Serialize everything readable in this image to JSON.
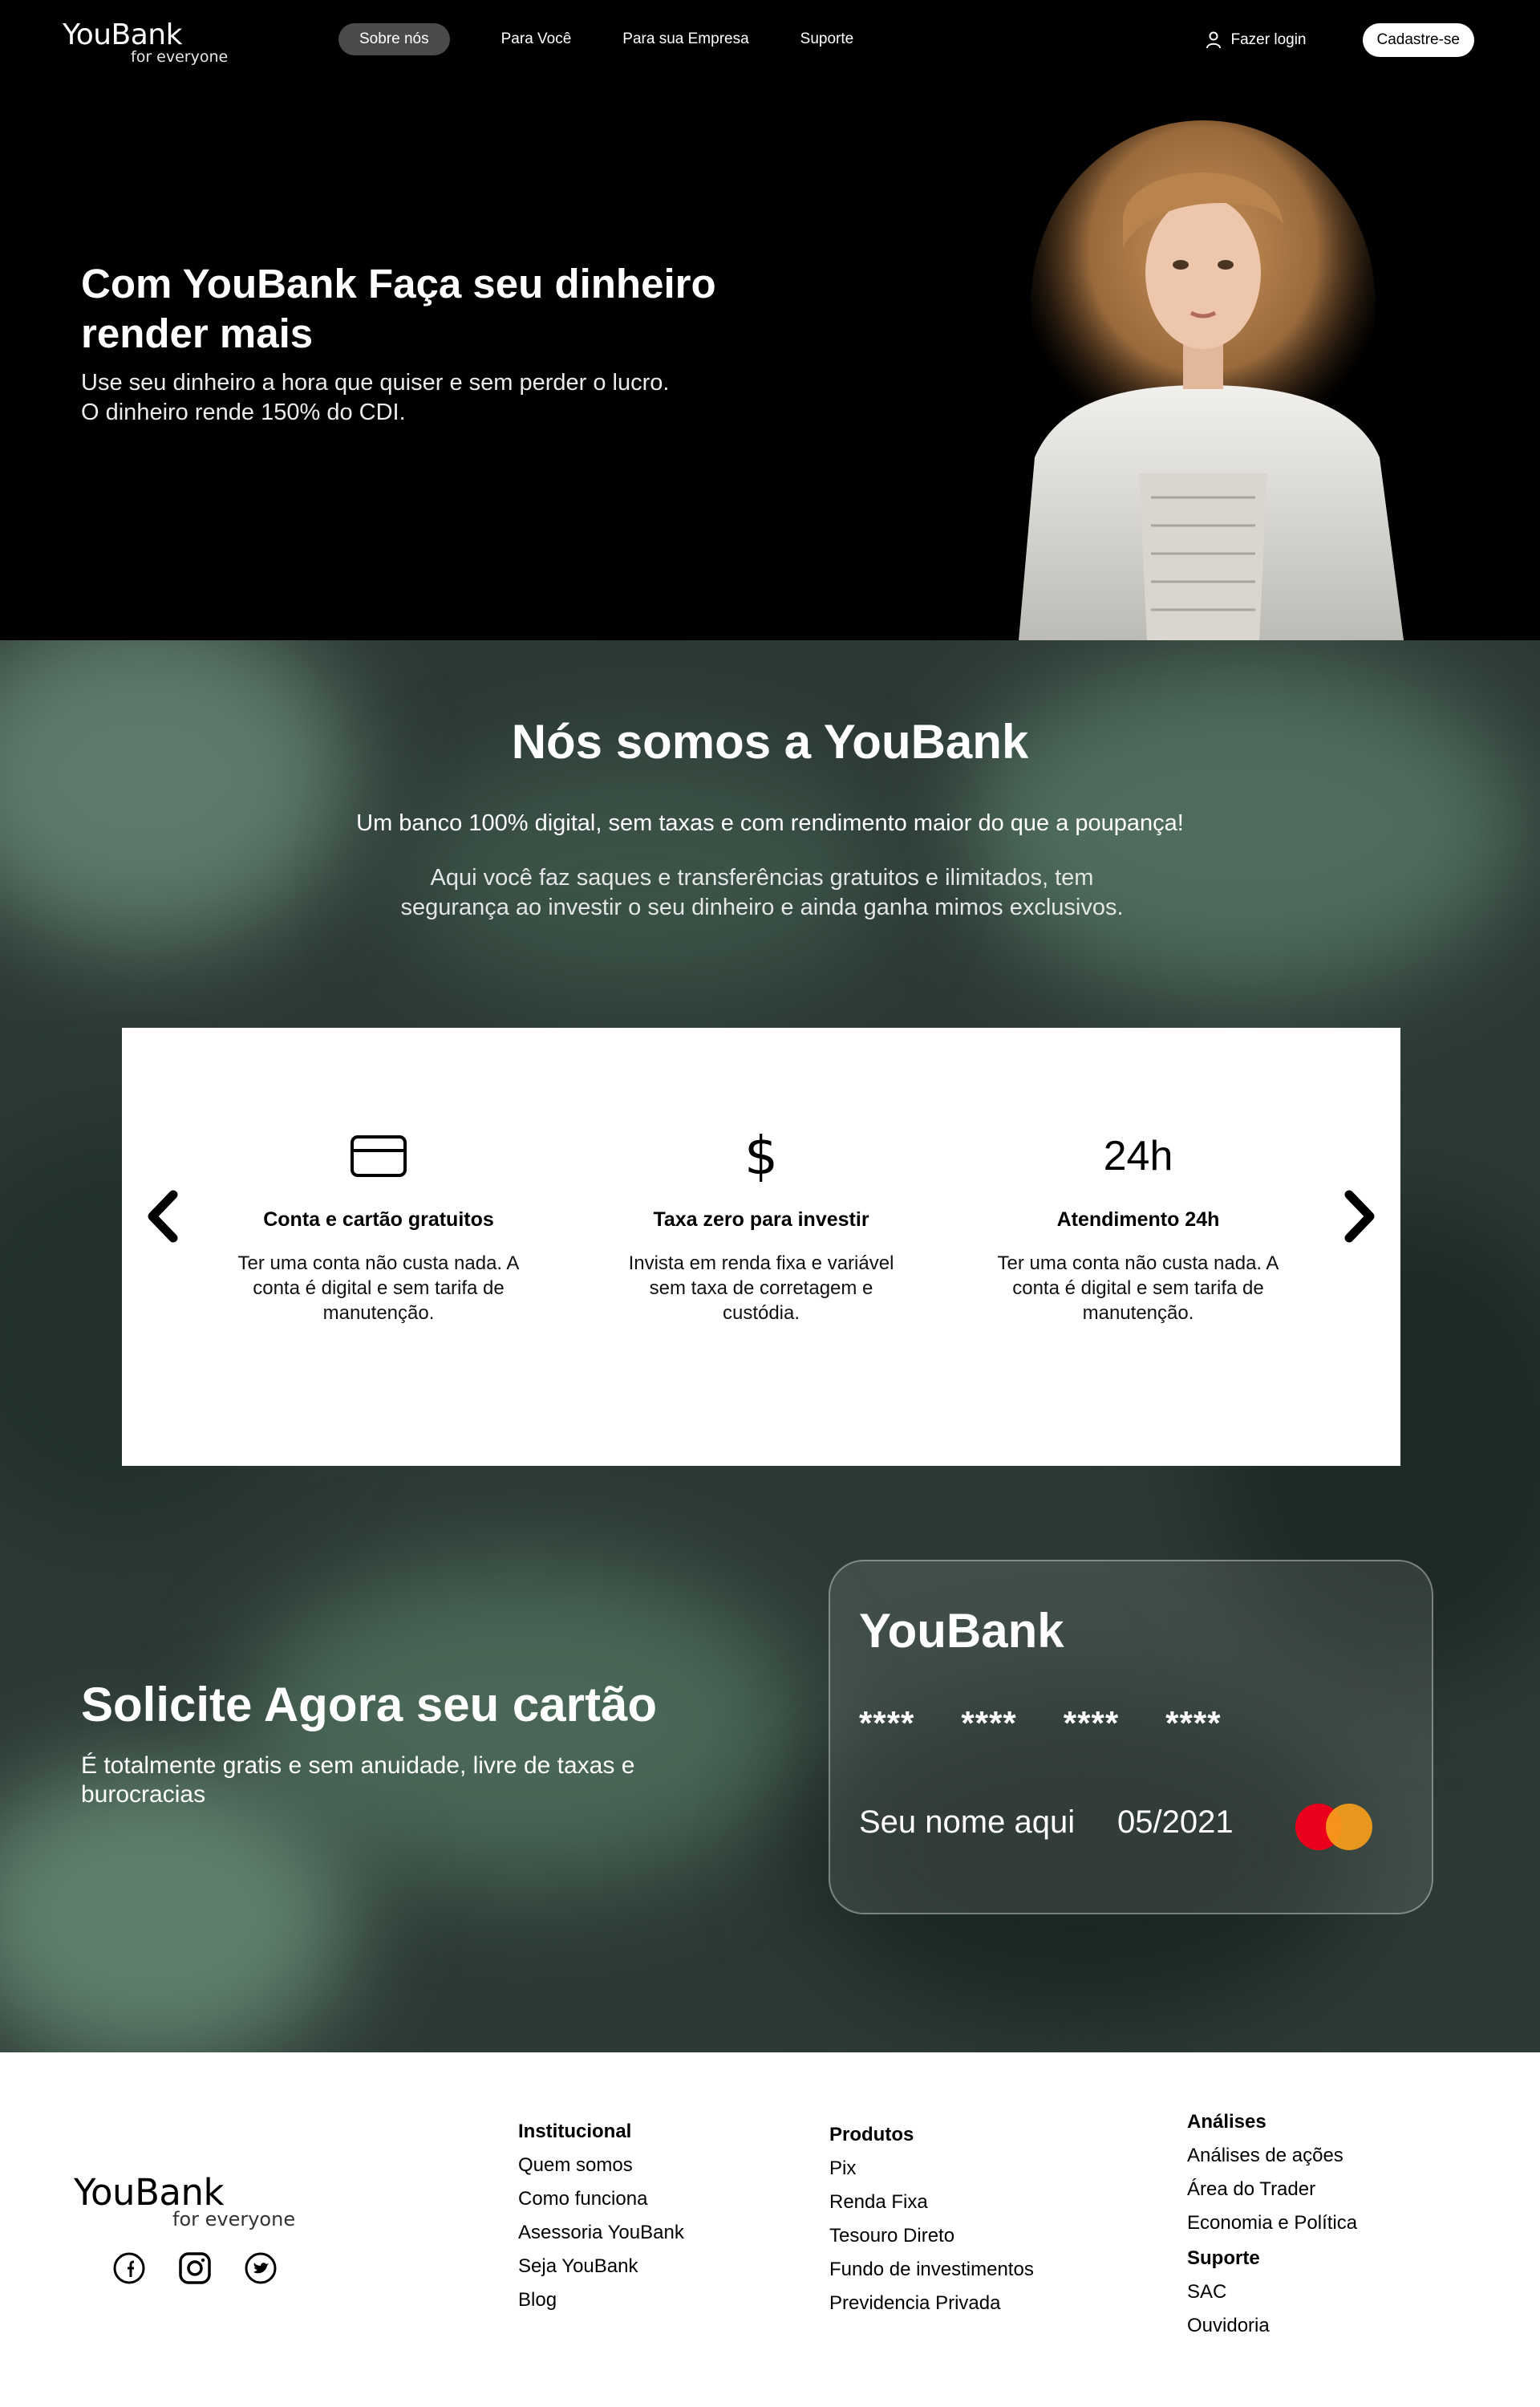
{
  "header": {
    "brand": "YouBank",
    "tagline": "for everyone",
    "nav": [
      "Sobre nós",
      "Para Você",
      "Para sua Empresa",
      "Suporte"
    ],
    "login": "Fazer login",
    "signup": "Cadastre-se"
  },
  "hero": {
    "title": "Com YouBank Faça seu dinheiro render mais",
    "subtitle": "Use seu dinheiro a hora que quiser e sem perder o lucro. O dinheiro rende 150% do CDI."
  },
  "about": {
    "title": "Nós somos a YouBank",
    "lead": "Um banco 100% digital, sem taxas e com rendimento maior do que a poupança!",
    "body": "Aqui você faz saques e transferências gratuitos e ilimitados, tem segurança ao investir o seu dinheiro e ainda ganha mimos exclusivos."
  },
  "features": [
    {
      "icon": "credit-card-icon",
      "title": "Conta e cartão gratuitos",
      "desc": "Ter uma conta não custa nada. A conta é digital e sem tarifa de manutenção."
    },
    {
      "icon": "dollar-icon",
      "icon_text": "$",
      "title": "Taxa zero para investir",
      "desc": "Invista em renda fixa e variável sem taxa de corretagem e custódia."
    },
    {
      "icon": "24h-icon",
      "icon_text": "24h",
      "title": "Atendimento 24h",
      "desc": "Ter uma conta não custa nada. A conta é digital e sem tarifa de manutenção."
    }
  ],
  "cta": {
    "title": "Solicite Agora seu cartão",
    "subtitle": "É totalmente gratis e sem anuidade, livre de taxas e burocracias"
  },
  "card": {
    "brand": "YouBank",
    "number_groups": [
      "****",
      "****",
      "****",
      "****"
    ],
    "holder": "Seu nome aqui",
    "expiry": "05/2021"
  },
  "footer": {
    "brand": "YouBank",
    "tagline": "for everyone",
    "social": [
      "facebook-icon",
      "instagram-icon",
      "twitter-icon"
    ],
    "institucional": {
      "title": "Institucional",
      "items": [
        "Quem somos",
        "Como funciona",
        "Asessoria YouBank",
        "Seja YouBank",
        "Blog"
      ]
    },
    "produtos": {
      "title": "Produtos",
      "items": [
        "Pix",
        "Renda Fixa",
        "Tesouro Direto",
        "Fundo de investimentos",
        "Previdencia Privada"
      ]
    },
    "analises": {
      "title": "Análises",
      "items": [
        "Análises de ações",
        "Área do Trader",
        "Economia e Política"
      ]
    },
    "suporte": {
      "title": "Suporte",
      "items": [
        "SAC",
        "Ouvidoria"
      ]
    }
  },
  "colors": {
    "hero_bg": "#000000",
    "green_bg": "#2c3a35",
    "mastercard_red": "#eb001b",
    "mastercard_orange": "#f79e1b"
  }
}
